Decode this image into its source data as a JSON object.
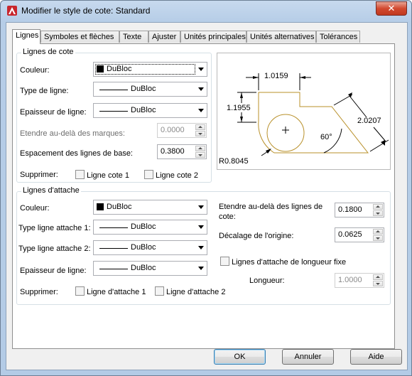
{
  "window": {
    "title": "Modifier le style de cote: Standard",
    "close_label": "✕"
  },
  "tabs": [
    {
      "label": "Lignes",
      "active": true
    },
    {
      "label": "Symboles et flèches",
      "active": false
    },
    {
      "label": "Texte",
      "active": false
    },
    {
      "label": "Ajuster",
      "active": false
    },
    {
      "label": "Unités principales",
      "active": false
    },
    {
      "label": "Unités alternatives",
      "active": false
    },
    {
      "label": "Tolérances",
      "active": false
    }
  ],
  "dim_lines": {
    "group_title": "Lignes de cote",
    "color_label": "Couleur:",
    "color_value": "DuBloc",
    "linetype_label": "Type de ligne:",
    "linetype_value": "DuBloc",
    "lineweight_label": "Epaisseur de ligne:",
    "lineweight_value": "DuBloc",
    "extend_ticks_label": "Etendre au-delà des marques:",
    "extend_ticks_value": "0.0000",
    "baseline_spacing_label": "Espacement des lignes de base:",
    "baseline_spacing_value": "0.3800",
    "suppress_label": "Supprimer:",
    "suppress_1": "Ligne cote 1",
    "suppress_2": "Ligne cote 2"
  },
  "ext_lines": {
    "group_title": "Lignes d'attache",
    "color_label": "Couleur:",
    "color_value": "DuBloc",
    "linetype1_label": "Type ligne attache 1:",
    "linetype1_value": "DuBloc",
    "linetype2_label": "Type ligne attache 2:",
    "linetype2_value": "DuBloc",
    "lineweight_label": "Epaisseur de ligne:",
    "lineweight_value": "DuBloc",
    "suppress_label": "Supprimer:",
    "suppress_1": "Ligne d'attache 1",
    "suppress_2": "Ligne d'attache 2",
    "extend_beyond_label_1": "Etendre au-delà des lignes de",
    "extend_beyond_label_2": "cote:",
    "extend_beyond_value": "0.1800",
    "offset_origin_label": "Décalage de l'origine:",
    "offset_origin_value": "0.0625",
    "fixed_length_label": "Lignes d'attache de longueur fixe",
    "length_label": "Longueur:",
    "length_value": "1.0000"
  },
  "preview": {
    "dim_top": "1.0159",
    "dim_left": "1.1955",
    "dim_right": "2.0207",
    "angle": "60°",
    "radius": "R0.8045",
    "outline_color": "#b8902a"
  },
  "buttons": {
    "ok": "OK",
    "cancel": "Annuler",
    "help": "Aide"
  },
  "colors": {
    "title_bar": "#b6cde7",
    "close": "#c7432c",
    "default_button_border": "#3c7fb1"
  }
}
